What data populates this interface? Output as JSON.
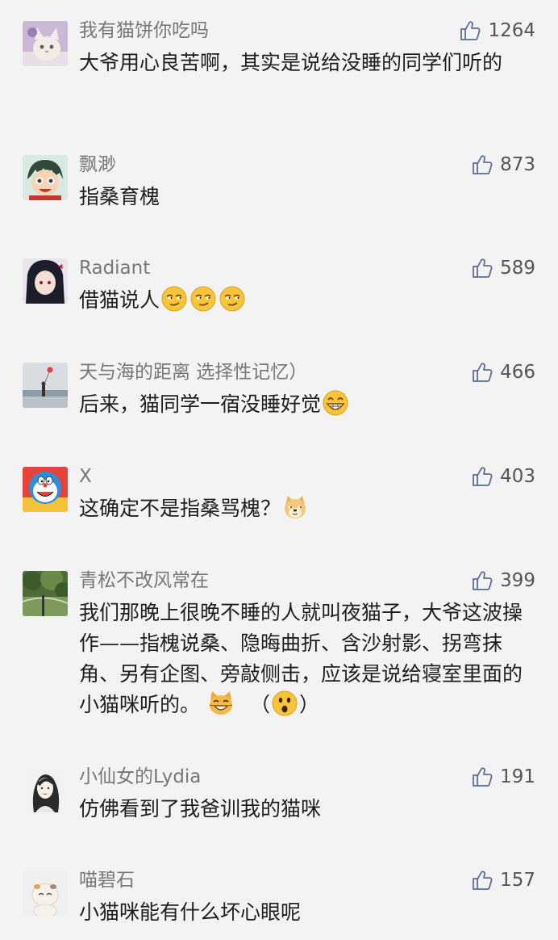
{
  "comments": [
    {
      "user": "我有猫饼你吃吗",
      "likes": "1264",
      "text": "大爷用心良苦啊，其实是说给没睡的同学们听的",
      "avatar": "cat-avatar"
    },
    {
      "user": "飘渺",
      "likes": "873",
      "text": "指桑育槐",
      "avatar": "anime-boy-avatar"
    },
    {
      "user": "Radiant",
      "likes": "589",
      "text": "借猫说人",
      "avatar": "anime-girl-avatar",
      "emojis": [
        "smirk-emoji",
        "smirk-emoji",
        "smirk-emoji"
      ]
    },
    {
      "user": "天与海的距离  选择性记忆）",
      "likes": "466",
      "text": "后来，猫同学一宿没睡好觉",
      "avatar": "sea-avatar",
      "emojis": [
        "grin-emoji"
      ]
    },
    {
      "user": "X",
      "likes": "403",
      "text": "这确定不是指桑骂槐？",
      "avatar": "doraemon-avatar",
      "emojis": [
        "doge-emoji"
      ]
    },
    {
      "user": "青松不改风常在",
      "likes": "399",
      "text": "我们那晚上很晚不睡的人就叫夜猫子，大爷这波操作——指槐说桑、隐晦曲折、含沙射影、拐弯抹角、另有企图、旁敲侧击，应该是说给寝室里面的小猫咪听的。",
      "avatar": "tree-avatar",
      "emojis": [
        "cat-emoji"
      ],
      "paren_open": "（",
      "paren_close": "）",
      "paren_emoji": "surprised-emoji"
    },
    {
      "user": "小仙女的Lydia",
      "likes": "191",
      "text": "仿佛看到了我爸训我的猫咪",
      "avatar": "girl-sketch-avatar"
    },
    {
      "user": "喵碧石",
      "likes": "157",
      "text": "小猫咪能有什么坏心眼呢",
      "avatar": "lucky-cat-avatar"
    }
  ]
}
